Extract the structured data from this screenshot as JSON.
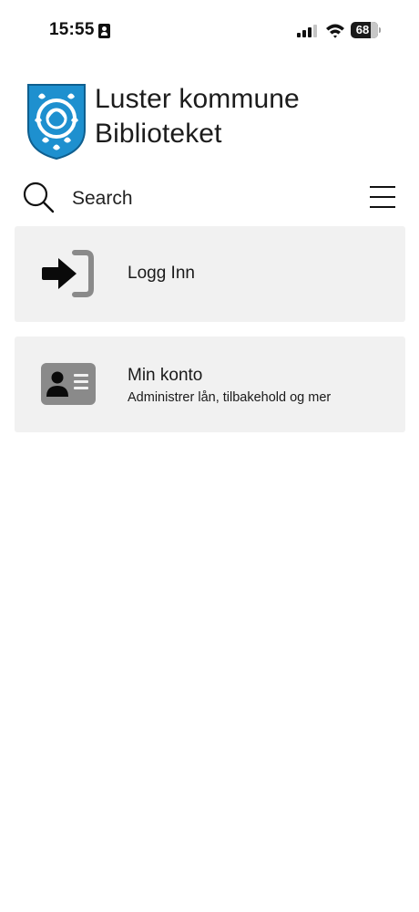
{
  "status_bar": {
    "time": "15:55",
    "battery": "68"
  },
  "brand": {
    "line1": "Luster kommune",
    "line2": "Biblioteket",
    "crest_color": "#1e90cf"
  },
  "search": {
    "label": "Search",
    "icon": "search-icon"
  },
  "menu": {
    "icon": "hamburger-menu-icon"
  },
  "cards": [
    {
      "title": "Logg Inn",
      "icon": "login-arrow-icon"
    },
    {
      "title": "Min konto",
      "subtitle": "Administrer lån, tilbakehold og mer",
      "icon": "id-card-icon"
    }
  ]
}
